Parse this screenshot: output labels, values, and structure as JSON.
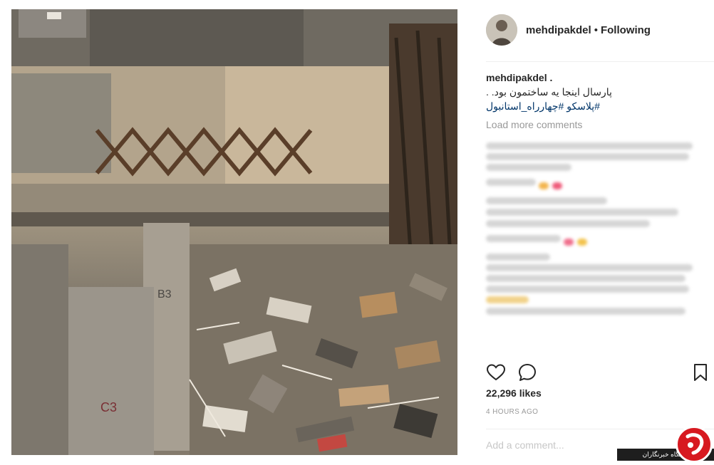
{
  "header": {
    "username": "mehdipakdel",
    "separator": "•",
    "follow_status": "Following"
  },
  "caption": {
    "username": "mehdipakdel .",
    "line1": "پارسال اینجا یه ساختمون بود. .",
    "hashtags": "#پلاسکو #چهارراه_استانبول"
  },
  "load_more": "Load more comments",
  "actions": {
    "like_icon": "heart-icon",
    "comment_icon": "comment-bubble-icon",
    "save_icon": "bookmark-icon"
  },
  "likes": "22,296 likes",
  "time": "4 HOURS AGO",
  "comment_input": {
    "placeholder": "Add a comment..."
  },
  "watermark": {
    "bar_text": "باشگاه خبرنگاران"
  },
  "colors": {
    "text": "#262626",
    "muted": "#999999",
    "link": "#003569",
    "watermark_red": "#d71920"
  }
}
